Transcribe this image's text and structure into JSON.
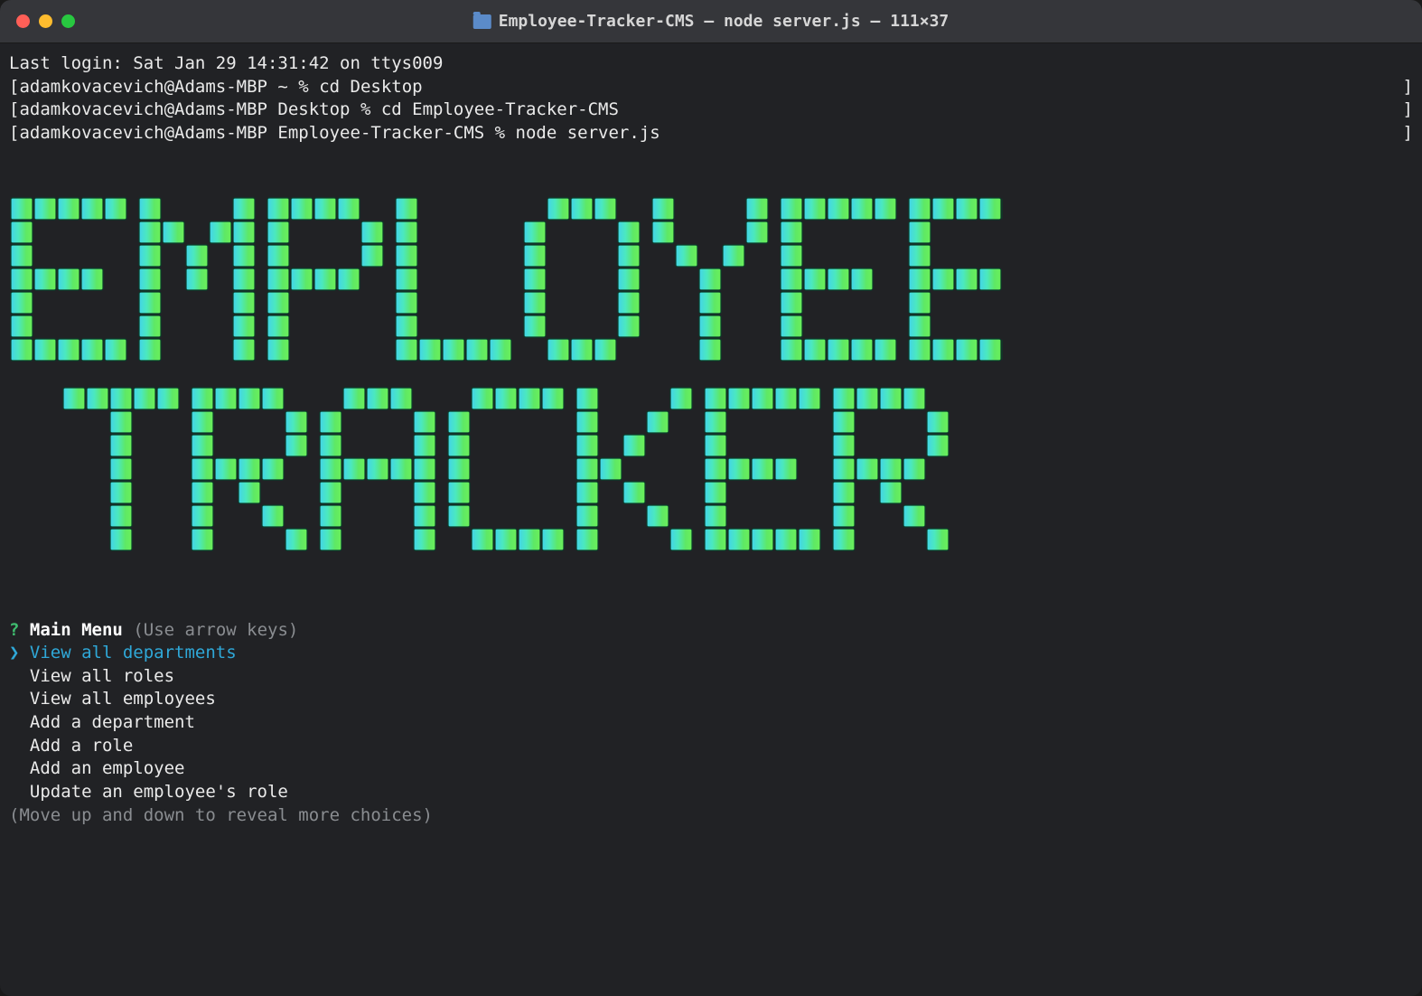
{
  "titlebar": {
    "title": "Employee-Tracker-CMS — node server.js — 111×37"
  },
  "terminal": {
    "last_login": "Last login: Sat Jan 29 14:31:42 on ttys009",
    "lines": [
      {
        "left_bracket": "[",
        "prompt": "adamkovacevich@Adams-MBP ~ % ",
        "cmd": "cd Desktop",
        "right_bracket": "]"
      },
      {
        "left_bracket": "[",
        "prompt": "adamkovacevich@Adams-MBP Desktop % ",
        "cmd": "cd Employee-Tracker-CMS",
        "right_bracket": "]"
      },
      {
        "left_bracket": "[",
        "prompt": "adamkovacevich@Adams-MBP Employee-Tracker-CMS % ",
        "cmd": "node server.js",
        "right_bracket": "]"
      }
    ],
    "banner": {
      "line1": "EMPLOYEE",
      "line2": "TRACKER"
    },
    "menu": {
      "q": "?",
      "title": "Main Menu",
      "hint": "(Use arrow keys)",
      "pointer": "❯",
      "options": [
        "View all departments",
        "View all roles",
        "View all employees",
        "Add a department",
        "Add a role",
        "Add an employee",
        "Update an employee's role"
      ],
      "help": "(Move up and down to reveal more choices)"
    }
  }
}
